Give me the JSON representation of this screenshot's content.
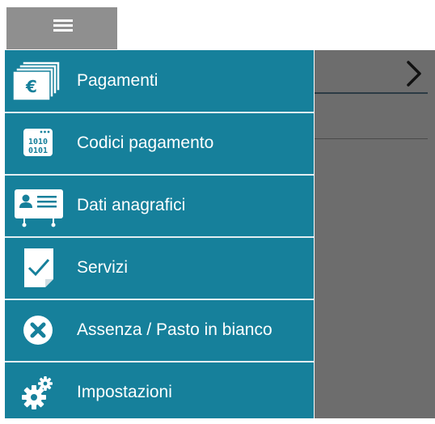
{
  "menu": {
    "items": [
      {
        "label": "Pagamenti",
        "icon": "euro-bills-icon"
      },
      {
        "label": "Codici pagamento",
        "icon": "binary-code-icon"
      },
      {
        "label": "Dati anagrafici",
        "icon": "id-card-icon"
      },
      {
        "label": "Servizi",
        "icon": "checkbox-document-icon"
      },
      {
        "label": "Assenza / Pasto in bianco",
        "icon": "x-circle-icon"
      },
      {
        "label": "Impostazioni",
        "icon": "gears-icon"
      }
    ]
  },
  "icons": {
    "euro_symbol": "€",
    "binary_top": "1010",
    "binary_bottom": "0101"
  },
  "colors": {
    "drawer_background": "#16809b",
    "scrim": "#6d6d6d",
    "toolbar_button": "#8f8f8f",
    "divider": "#e3eef2",
    "text": "#ffffff"
  }
}
